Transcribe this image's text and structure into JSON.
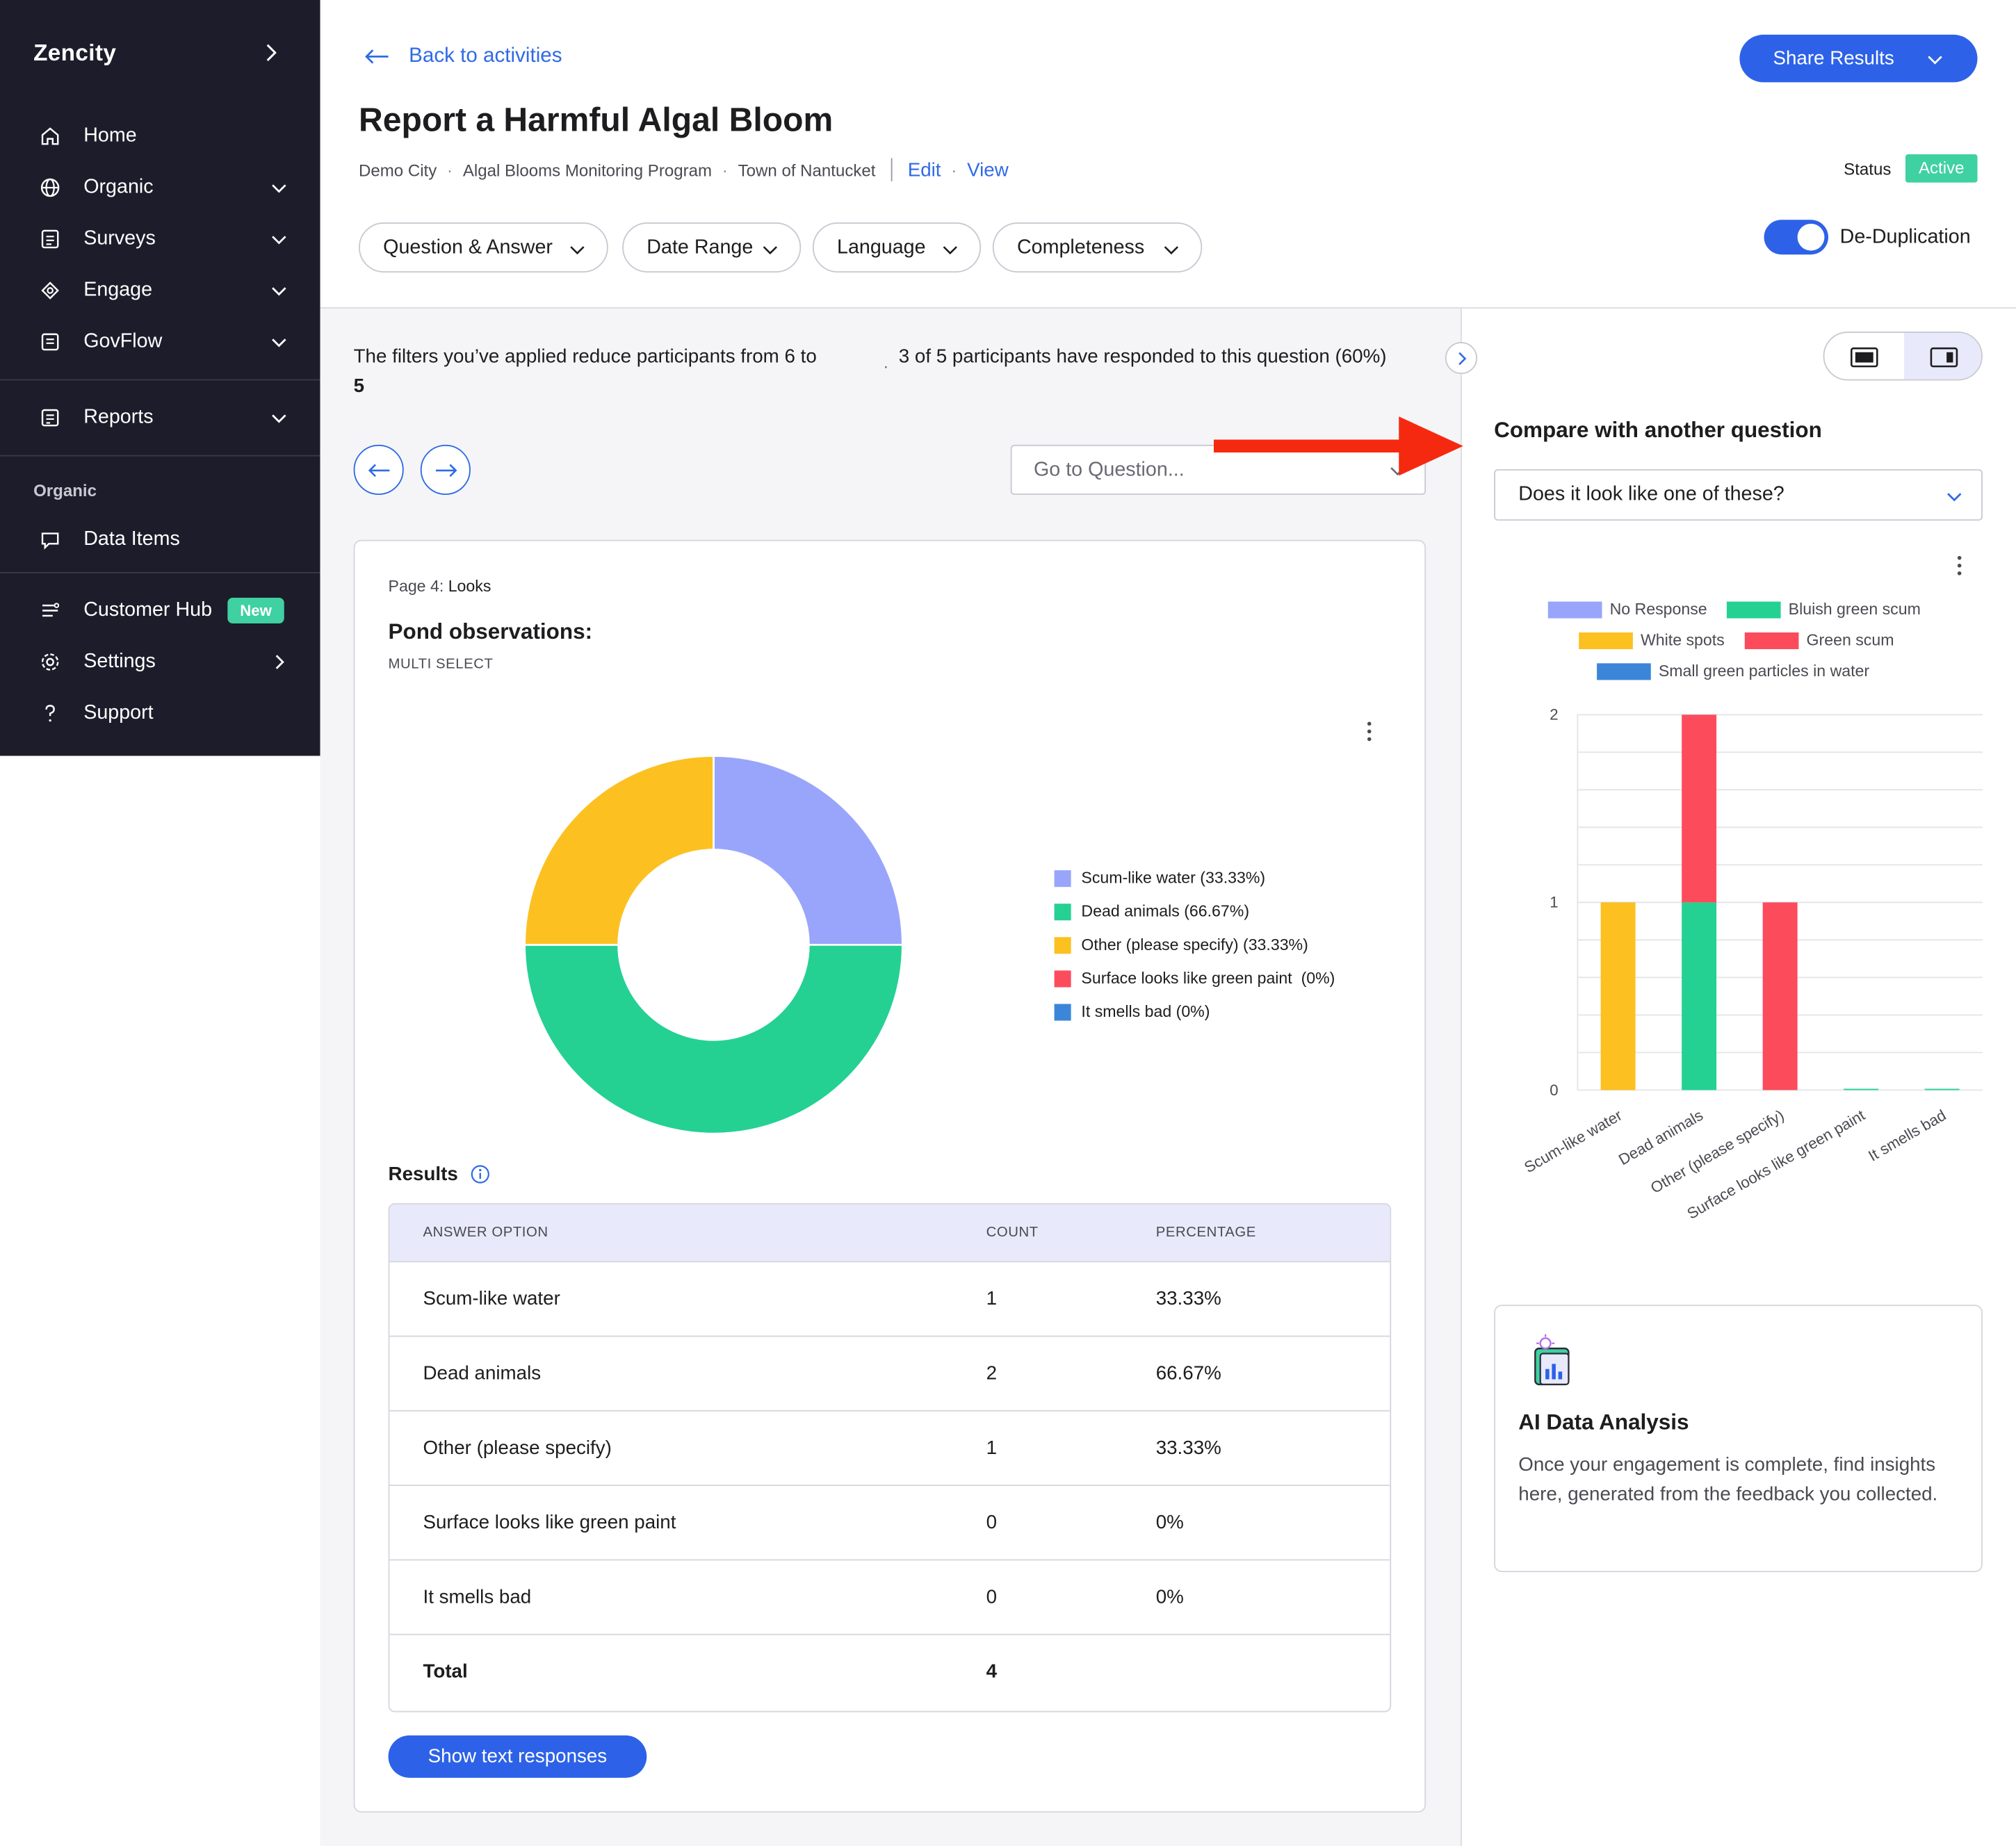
{
  "sidebar": {
    "brand": "Zencity",
    "items": [
      {
        "label": "Home",
        "icon": "home-icon"
      },
      {
        "label": "Organic",
        "icon": "globe-icon"
      },
      {
        "label": "Surveys",
        "icon": "survey-icon"
      },
      {
        "label": "Engage",
        "icon": "engage-icon"
      },
      {
        "label": "GovFlow",
        "icon": "govflow-icon"
      },
      {
        "label": "Reports",
        "icon": "reports-icon"
      }
    ],
    "section_label": "Organic",
    "data_items": "Data Items",
    "customer_hub": "Customer Hub",
    "new_badge": "New",
    "settings": "Settings",
    "support": "Support"
  },
  "header": {
    "back_link": "Back to activities",
    "title": "Report a Harmful Algal Bloom",
    "breadcrumbs": [
      "Demo City",
      "Algal Blooms Monitoring Program",
      "Town of Nantucket"
    ],
    "edit": "Edit",
    "view": "View",
    "share_button": "Share Results",
    "status_label": "Status",
    "status_value": "Active",
    "filters": [
      "Question & Answer",
      "Date Range",
      "Language",
      "Completeness"
    ],
    "dedup_label": "De-Duplication",
    "dedup_on": true
  },
  "info": {
    "filters_text": "The filters you’ve applied reduce participants from 6 to",
    "filters_count": "5",
    "responded_text": "3 of 5 participants have responded to this question (60%)",
    "goto_placeholder": "Go to Question..."
  },
  "question": {
    "page_prefix": "Page 4:",
    "page_name": "Looks",
    "title": "Pond observations:",
    "type": "MULTI SELECT",
    "results_label": "Results",
    "columns": [
      "ANSWER OPTION",
      "COUNT",
      "PERCENTAGE"
    ],
    "rows": [
      {
        "option": "Scum-like water",
        "count": "1",
        "pct": "33.33%"
      },
      {
        "option": "Dead animals",
        "count": "2",
        "pct": "66.67%"
      },
      {
        "option": "Other (please specify)",
        "count": "1",
        "pct": "33.33%"
      },
      {
        "option": "Surface looks like green paint",
        "count": "0",
        "pct": "0%"
      },
      {
        "option": "It smells bad",
        "count": "0",
        "pct": "0%"
      }
    ],
    "total_label": "Total",
    "total_count": "4",
    "show_text_button": "Show text responses"
  },
  "chart_data": [
    {
      "type": "pie",
      "style": "donut",
      "categories": [
        "Scum-like water (33.33%)",
        "Dead animals (66.67%)",
        "Other (please specify) (33.33%)",
        "Surface looks like green paint  (0%)",
        "It smells bad (0%)"
      ],
      "values": [
        1,
        2,
        1,
        0,
        0
      ],
      "colors": [
        "#99a5fb",
        "#24d192",
        "#fcc021",
        "#fc4c5c",
        "#3b86d9"
      ]
    },
    {
      "type": "bar",
      "stacked": true,
      "categories": [
        "Scum-like water",
        "Dead animals",
        "Other (please specify)",
        "Surface looks like green paint",
        "It smells bad"
      ],
      "series": [
        {
          "name": "No Response",
          "color": "#99a5fb",
          "values": [
            0,
            0,
            0,
            0,
            0
          ]
        },
        {
          "name": "Bluish green scum",
          "color": "#24d192",
          "values": [
            0,
            1,
            0,
            0,
            0
          ]
        },
        {
          "name": "White spots",
          "color": "#fcc021",
          "values": [
            1,
            0,
            0,
            0,
            0
          ]
        },
        {
          "name": "Green scum",
          "color": "#fc4c5c",
          "values": [
            0,
            1,
            1,
            0,
            0
          ]
        },
        {
          "name": "Small green particles in water",
          "color": "#3b86d9",
          "values": [
            0,
            0,
            0,
            0,
            0
          ]
        }
      ],
      "ylim": [
        0,
        2
      ],
      "yticks": [
        "0",
        "1",
        "2"
      ],
      "legend_position": "top",
      "grid": true
    }
  ],
  "compare": {
    "title": "Compare with another question",
    "selected": "Does it look like one of these?"
  },
  "ai": {
    "title": "AI Data Analysis",
    "body": "Once your engagement is complete, find insights here, generated from the feedback you collected."
  }
}
